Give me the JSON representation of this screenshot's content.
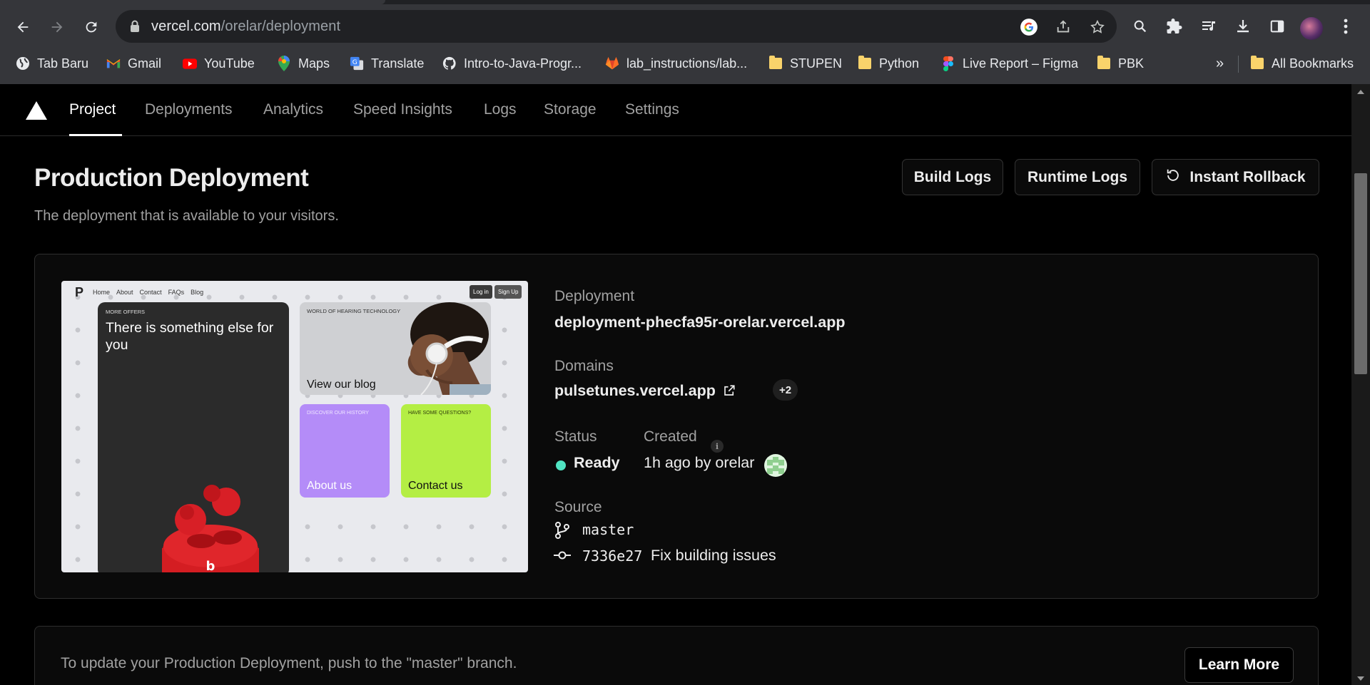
{
  "browser": {
    "url_host": "vercel.com",
    "url_path": "/orelar/deployment",
    "bookmarks": [
      {
        "label": "Tab Baru",
        "icon": "globe-icon"
      },
      {
        "label": "Gmail",
        "icon": "gmail-icon"
      },
      {
        "label": "YouTube",
        "icon": "youtube-icon"
      },
      {
        "label": "Maps",
        "icon": "maps-icon"
      },
      {
        "label": "Translate",
        "icon": "translate-icon"
      },
      {
        "label": "Intro-to-Java-Progr...",
        "icon": "github-icon"
      },
      {
        "label": "lab_instructions/lab...",
        "icon": "gitlab-icon"
      },
      {
        "label": "STUPEN",
        "icon": "folder-icon"
      },
      {
        "label": "Python",
        "icon": "folder-icon"
      },
      {
        "label": "Live Report – Figma",
        "icon": "figma-icon"
      },
      {
        "label": "PBK",
        "icon": "folder-icon"
      }
    ],
    "overflow_label": "»",
    "all_bookmarks": "All Bookmarks"
  },
  "nav": {
    "tabs": [
      "Project",
      "Deployments",
      "Analytics",
      "Speed Insights",
      "Logs",
      "Storage",
      "Settings"
    ],
    "active": "Project"
  },
  "header": {
    "title": "Production Deployment",
    "subtitle": "The deployment that is available to your visitors.",
    "build_logs": "Build Logs",
    "runtime_logs": "Runtime Logs",
    "instant_rollback": "Instant Rollback"
  },
  "preview": {
    "logo": "P",
    "nav": [
      "Home",
      "About",
      "Contact",
      "FAQs",
      "Blog"
    ],
    "login": "Log in",
    "signup": "Sign Up",
    "offers_tag": "MORE OFFERS",
    "offers_text": "There is something else for you",
    "blog_tag": "WORLD OF HEARING TECHNOLOGY",
    "blog_label": "View our blog",
    "about_tag": "DISCOVER OUR HISTORY",
    "about_label": "About us",
    "contact_tag": "HAVE SOME QUESTIONS?",
    "contact_label": "Contact us"
  },
  "deployment": {
    "deployment_label": "Deployment",
    "deployment_url": "deployment-phecfa95r-orelar.vercel.app",
    "domains_label": "Domains",
    "domain": "pulsetunes.vercel.app",
    "domains_more": "+2",
    "status_label": "Status",
    "status_value": "Ready",
    "status_color": "#50e3c2",
    "created_label": "Created",
    "created_value": "1h ago by orelar",
    "source_label": "Source",
    "branch": "master",
    "commit_hash": "7336e27",
    "commit_message": "Fix building issues"
  },
  "footer_card": {
    "text": "To update your Production Deployment, push to the \"master\" branch.",
    "learn_more": "Learn More"
  }
}
